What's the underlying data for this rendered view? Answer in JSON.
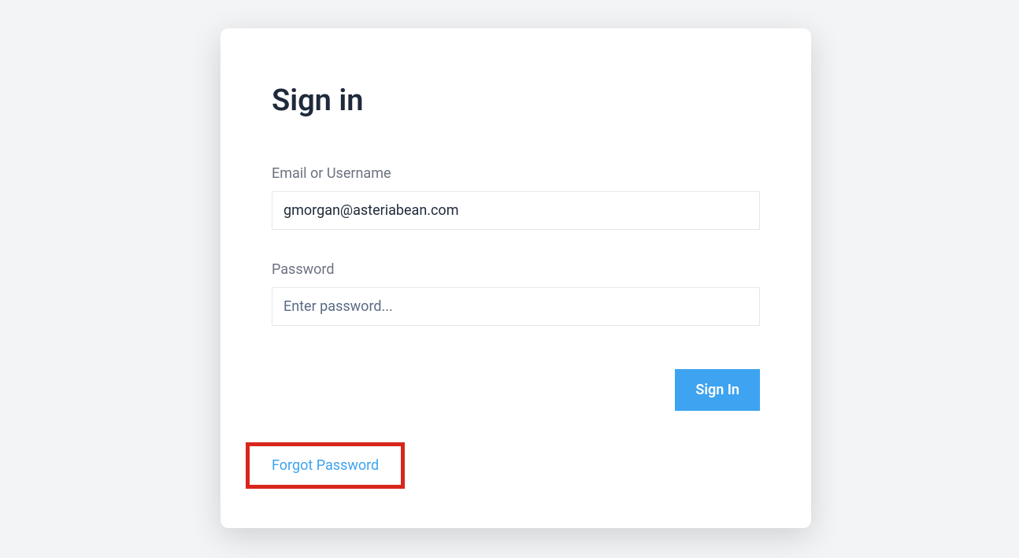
{
  "title": "Sign in",
  "email": {
    "label": "Email or Username",
    "value": "gmorgan@asteriabean.com"
  },
  "password": {
    "label": "Password",
    "placeholder": "Enter password..."
  },
  "buttons": {
    "signin": "Sign In"
  },
  "links": {
    "forgot": "Forgot Password"
  }
}
